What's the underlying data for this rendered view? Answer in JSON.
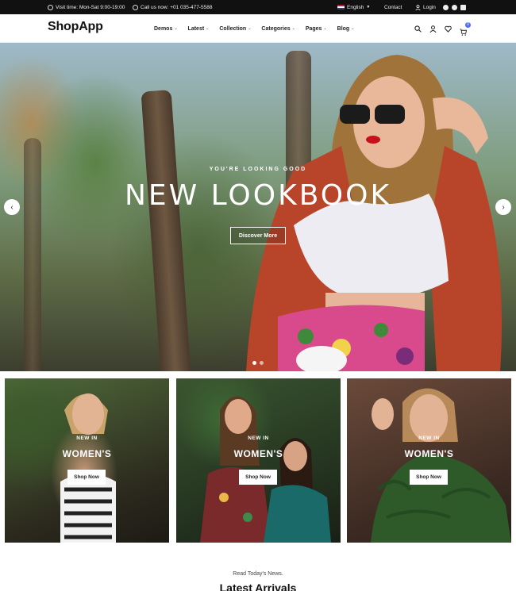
{
  "topbar": {
    "visit_time": "Visit time: Mon-Sat 9:00-19:00",
    "call_us": "Call us now: +01 035-477-5588",
    "language": "English",
    "contact": "Contact",
    "login": "Login"
  },
  "header": {
    "logo": "ShopApp",
    "nav": [
      "Demos",
      "Latest",
      "Collection",
      "Categories",
      "Pages",
      "Blog"
    ],
    "cart_count": "0"
  },
  "hero": {
    "subtitle": "YOU'RE LOOKING GOOD",
    "title": "NEW LOOKBOOK",
    "button": "Discover More",
    "prev_icon": "chevron-left-icon",
    "next_icon": "chevron-right-icon"
  },
  "cards": [
    {
      "kicker": "NEW IN",
      "title": "WOMEN'S",
      "button": "Shop Now"
    },
    {
      "kicker": "NEW IN",
      "title": "WOMEN'S",
      "button": "Shop Now"
    },
    {
      "kicker": "NEW IN",
      "title": "WOMEN'S",
      "button": "Shop Now"
    }
  ],
  "section": {
    "kicker": "Read Today's News.",
    "title": "Latest Arrivals"
  },
  "colors": {
    "topbar_bg": "#111111",
    "accent": "#4a6cf7",
    "jacket": "#b8452a"
  }
}
